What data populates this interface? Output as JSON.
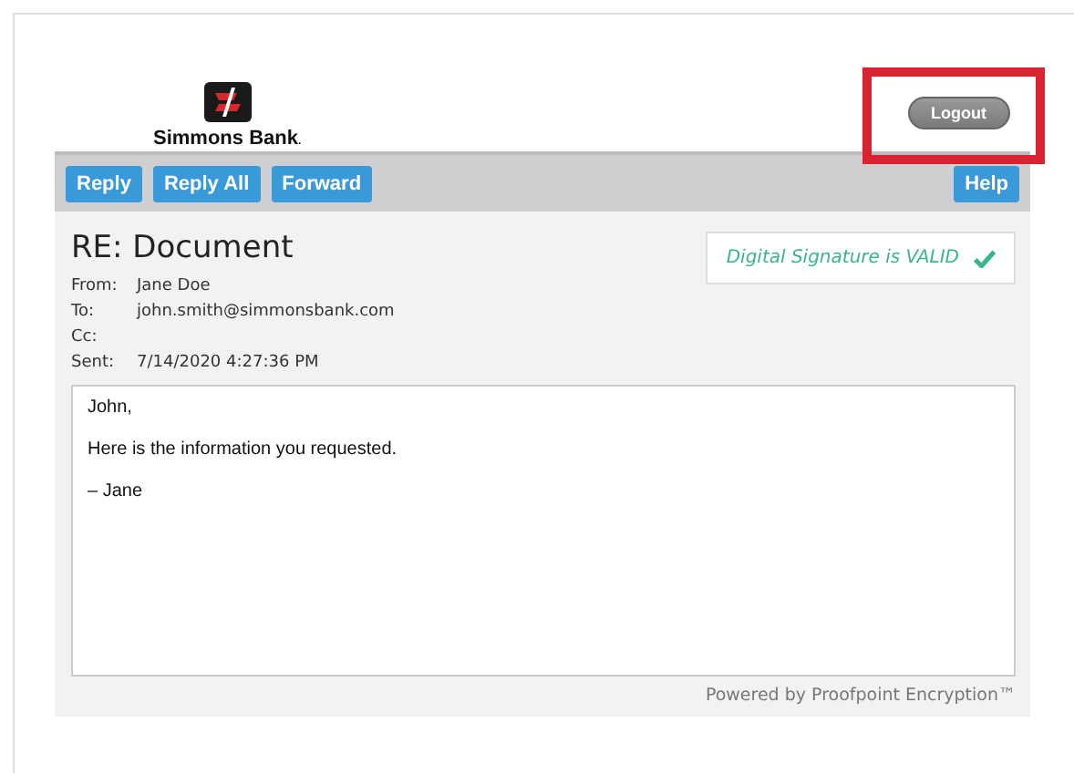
{
  "brand": {
    "name": "Simmons Bank",
    "trademark": "."
  },
  "logout": {
    "label": "Logout",
    "highlighted": true
  },
  "toolbar": {
    "buttons": [
      "Reply",
      "Reply All",
      "Forward"
    ],
    "help": "Help"
  },
  "message": {
    "subject": "RE: Document",
    "signature_status": "Digital Signature is VALID",
    "signature_valid": true,
    "headers": [
      {
        "label": "From:",
        "value": "Jane Doe"
      },
      {
        "label": "To:",
        "value": "john.smith@simmonsbank.com"
      },
      {
        "label": "Cc:"
      },
      {
        "label": "Sent:",
        "value": "7/14/2020 4:27:36 PM"
      }
    ],
    "body": [
      "John,",
      "Here is the information you requested.",
      "– Jane"
    ]
  },
  "footer": "Powered by Proofpoint Encryption™"
}
